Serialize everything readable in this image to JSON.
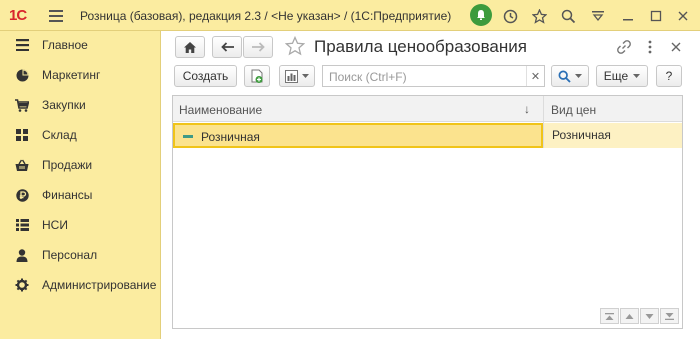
{
  "titlebar": {
    "logo": "1С",
    "title": "Розница (базовая), редакция 2.3 / <Не указан> /  (1С:Предприятие)"
  },
  "sidebar": {
    "items": [
      {
        "label": "Главное",
        "icon": "menu-lines-icon"
      },
      {
        "label": "Маркетинг",
        "icon": "pie-chart-icon"
      },
      {
        "label": "Закупки",
        "icon": "cart-icon"
      },
      {
        "label": "Склад",
        "icon": "grid-icon"
      },
      {
        "label": "Продажи",
        "icon": "basket-icon"
      },
      {
        "label": "Финансы",
        "icon": "ruble-icon"
      },
      {
        "label": "НСИ",
        "icon": "list-icon"
      },
      {
        "label": "Персонал",
        "icon": "person-icon"
      },
      {
        "label": "Администрирование",
        "icon": "gear-icon"
      }
    ]
  },
  "form": {
    "title": "Правила ценообразования",
    "create_label": "Создать",
    "search_placeholder": "Поиск (Ctrl+F)",
    "more_label": "Еще",
    "help_label": "?"
  },
  "table": {
    "columns": [
      "Наименование",
      "Вид цен"
    ],
    "sort_indicator": "↓",
    "rows": [
      {
        "name": "Розничная",
        "price_type": "Розничная"
      }
    ]
  },
  "colors": {
    "panel": "#fbeca0",
    "selected_row": "#fbe38e",
    "selected_border": "#f0c419",
    "accent_green": "#3d9b3d",
    "logo_red": "#d8262d"
  }
}
